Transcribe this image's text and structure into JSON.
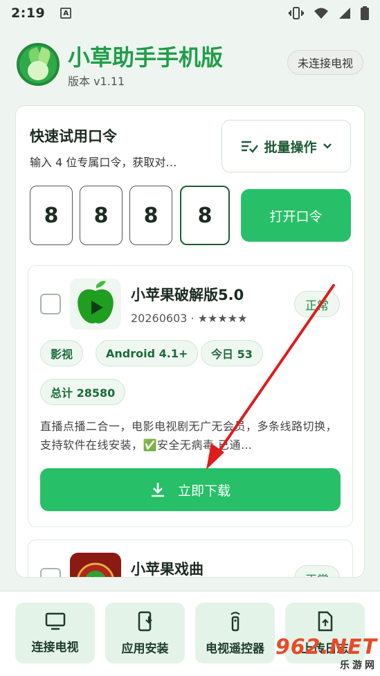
{
  "status_bar": {
    "time": "2:19",
    "notif_icon": "A"
  },
  "header": {
    "title": "小草助手手机版",
    "version": "版本 v1.11",
    "tv_status": "未连接电视"
  },
  "quick": {
    "title": "快速试用口令",
    "subtitle": "输入 4 位专属口令，获取对…",
    "batch_label": "批量操作",
    "code_digits": [
      "8",
      "8",
      "8",
      "8"
    ],
    "open_label": "打开口令"
  },
  "apps": [
    {
      "name": "小苹果破解版5.0",
      "date": "20260603",
      "rating_stars": "★★★★★",
      "status": "正常",
      "tags": [
        "影视",
        "Android 4.1+",
        "今日 53",
        "总计 28580"
      ],
      "description": "直播点播二合一，电影电视剧无广无会员，多条线路切换，支持软件在线安装，✅安全无病毒,已通…",
      "download_label": "立即下载"
    },
    {
      "name": "小苹果戏曲",
      "status": "正常"
    }
  ],
  "bottom_nav": [
    {
      "label": "连接电视",
      "icon": "tv-icon"
    },
    {
      "label": "应用安装",
      "icon": "phone-install-icon"
    },
    {
      "label": "电视遥控器",
      "icon": "remote-icon"
    },
    {
      "label": "上传日志",
      "icon": "upload-file-icon"
    }
  ],
  "watermark": {
    "big": "962.NET",
    "small": "乐游网"
  },
  "colors": {
    "accent": "#27c068",
    "title_green": "#1f9e48",
    "arrow_red": "#e01b1b"
  }
}
